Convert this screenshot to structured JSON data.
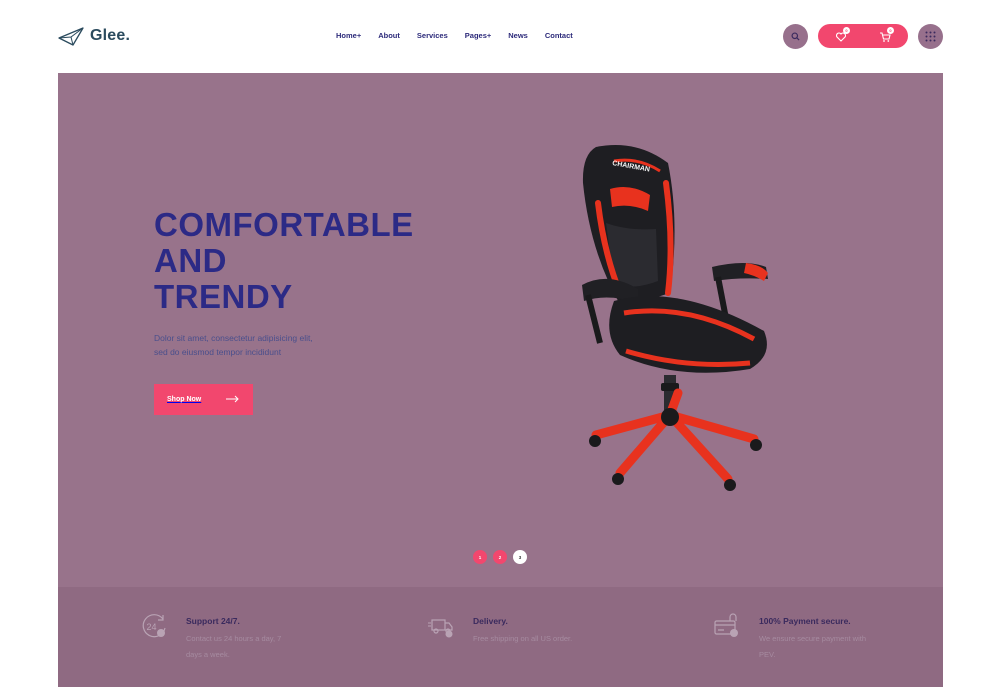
{
  "header": {
    "logo_text": "Glee.",
    "nav": [
      "Home+",
      "About",
      "Services",
      "Pages+",
      "News",
      "Contact"
    ],
    "wishlist_count": "0",
    "cart_count": "0",
    "icons": {
      "search": "search-icon",
      "wishlist": "heart-icon",
      "cart": "cart-icon",
      "menu": "grid-menu-icon"
    }
  },
  "hero": {
    "title_lines": [
      "COMFORTABLE",
      "AND",
      "TRENDY"
    ],
    "description_lines": [
      "Dolor sit amet, consectetur adipisicing elit,",
      "sed do eiusmod tempor incididunt"
    ],
    "button_label": "Shop Now",
    "slides": [
      "1",
      "2",
      "3"
    ],
    "active_slide": "3"
  },
  "features": [
    {
      "title": "Support 24/7.",
      "desc": "Contact us 24 hours a day, 7 days a week.",
      "icon": "support-24-icon"
    },
    {
      "title": "Delivery.",
      "desc": "Free shipping on all US order.",
      "icon": "delivery-truck-icon"
    },
    {
      "title": "100% Payment secure.",
      "desc": "We ensure secure payment with PEV.",
      "icon": "secure-payment-icon"
    }
  ],
  "colors": {
    "accent": "#f2476e",
    "hero_bg": "#98738b",
    "title": "#2c2a86",
    "features_bg": "#8f6a82"
  }
}
